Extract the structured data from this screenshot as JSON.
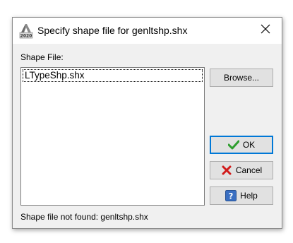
{
  "dialog": {
    "title": "Specify shape file for genltshp.shx",
    "app_icon": "autocad-2020-icon",
    "close_icon": "close-icon"
  },
  "shape_file": {
    "label": "Shape File:",
    "items": [
      "LTypeShp.shx"
    ],
    "selected_index": 0
  },
  "buttons": {
    "browse_label": "Browse...",
    "ok_label": "OK",
    "ok_icon": "checkmark-icon",
    "ok_icon_color": "#2e9e2e",
    "cancel_label": "Cancel",
    "cancel_icon": "red-x-icon",
    "cancel_icon_color": "#d11a1a",
    "help_label": "Help",
    "help_icon": "question-mark-icon",
    "help_icon_color": "#3a6fc2"
  },
  "status": {
    "message": "Shape file not found: genltshp.shx"
  },
  "colors": {
    "accent": "#0078d7"
  }
}
